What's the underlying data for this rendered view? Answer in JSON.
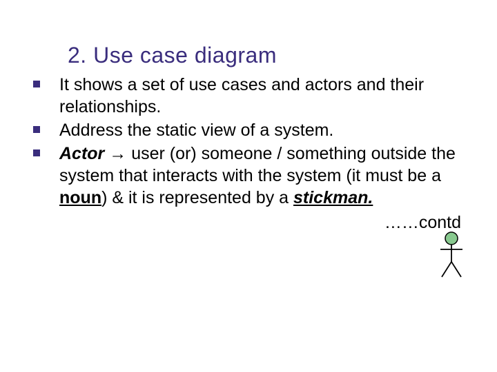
{
  "title": "2. Use case diagram",
  "bullets": [
    {
      "text": "It shows a set of use cases and actors and their relationships."
    },
    {
      "text": "Address the static view of a system."
    },
    {
      "actor_label": "Actor",
      "arrow": " → ",
      "after_arrow": "user (or) someone / something outside the system that interacts with the system (it must be a ",
      "noun_label": "noun",
      "after_noun": ") & it is represented by a ",
      "stickman_label": "stickman.",
      "tail": ""
    }
  ],
  "contd": "……contd",
  "icons": {
    "stickman": "stickman-icon"
  },
  "colors": {
    "accent": "#3a2d7d",
    "stickman_head": "#88c98f",
    "stickman_body": "#000000"
  }
}
